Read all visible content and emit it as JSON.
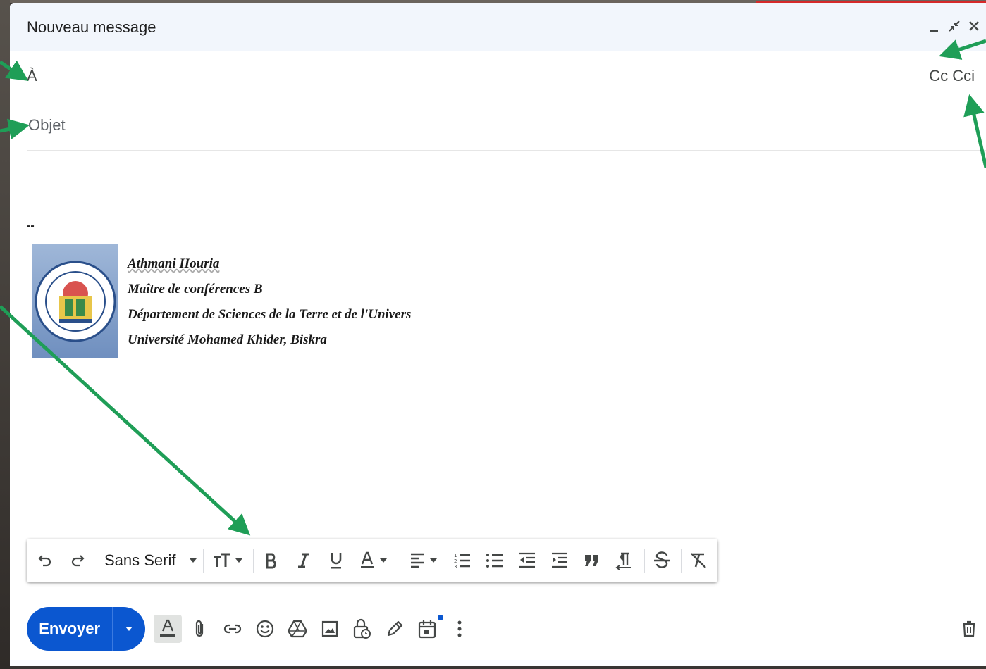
{
  "compose": {
    "title": "Nouveau message",
    "to_label": "À",
    "to_value": "",
    "cc_label": "Cc",
    "bcc_label": "Cci",
    "subject_placeholder": "Objet",
    "subject_value": ""
  },
  "signature": {
    "separator": "--",
    "name": "Athmani Houria",
    "role": "Maître de conférences B",
    "department": "Département de Sciences de la Terre et de l'Univers",
    "university": "Université Mohamed Khider, Biskra"
  },
  "toolbar": {
    "font": "Sans Serif"
  },
  "actions": {
    "send_label": "Envoyer"
  },
  "colors": {
    "accent": "#0b57d0",
    "annotation_arrow": "#1f9e57",
    "header_bg": "#f2f6fc"
  },
  "icons": [
    "minimize-icon",
    "exit-fullscreen-icon",
    "close-icon",
    "undo-icon",
    "redo-icon",
    "chevron-down-icon",
    "text-size-icon",
    "bold-icon",
    "italic-icon",
    "underline-icon",
    "text-color-icon",
    "align-icon",
    "numbered-list-icon",
    "bulleted-list-icon",
    "indent-less-icon",
    "indent-more-icon",
    "quote-icon",
    "rtl-icon",
    "strikethrough-icon",
    "remove-formatting-icon",
    "formatting-icon",
    "attach-icon",
    "link-icon",
    "emoji-icon",
    "drive-icon",
    "photo-icon",
    "confidential-icon",
    "signature-icon",
    "schedule-icon",
    "more-options-icon",
    "trash-icon"
  ]
}
